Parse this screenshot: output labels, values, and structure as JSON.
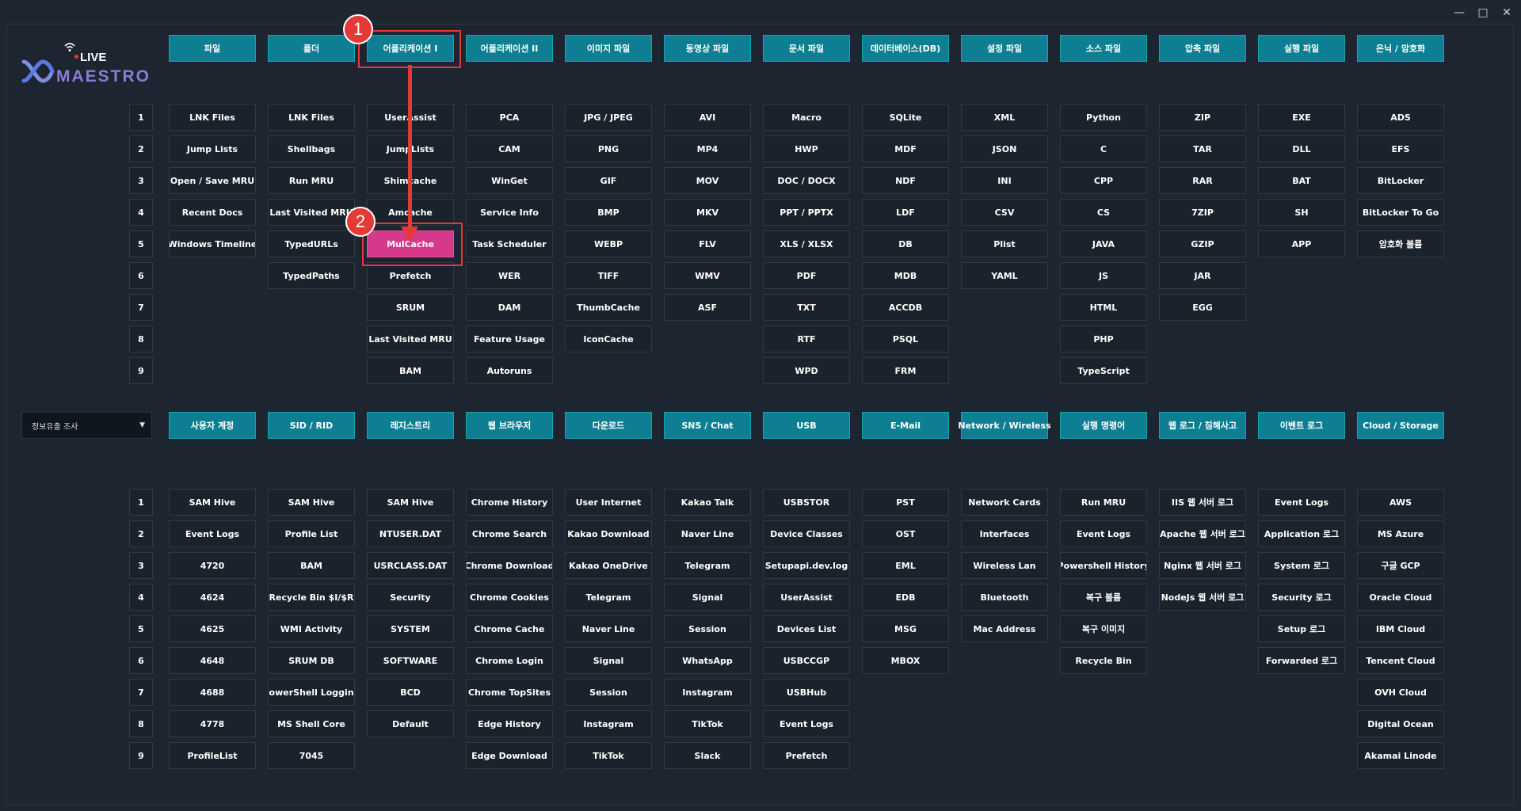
{
  "window_controls": {
    "minimize": "—",
    "maximize": "□",
    "close": "✕"
  },
  "logo": {
    "live": "LIVE",
    "main": "MAESTRO"
  },
  "top_categories": [
    "파일",
    "폴더",
    "어플리케이션 I",
    "어플리케이션 II",
    "이미지 파일",
    "동영상 파일",
    "문서 파일",
    "데이터베이스(DB)",
    "설정 파일",
    "소스 파일",
    "압축 파일",
    "실행 파일",
    "은닉 / 암호화"
  ],
  "top_rows": [
    [
      "LNK Files",
      "Jump Lists",
      "Open / Save MRU",
      "Recent Docs",
      "Windows Timeline",
      "",
      "",
      "",
      ""
    ],
    [
      "LNK Files",
      "Shellbags",
      "Run MRU",
      "Last Visited MRU",
      "TypedURLs",
      "TypedPaths",
      "",
      "",
      ""
    ],
    [
      "UserAssist",
      "JumpLists",
      "Shimcache",
      "Amcache",
      "MulCache",
      "Prefetch",
      "SRUM",
      "Last Visited MRU",
      "BAM"
    ],
    [
      "PCA",
      "CAM",
      "WinGet",
      "Service Info",
      "Task Scheduler",
      "WER",
      "DAM",
      "Feature Usage",
      "Autoruns"
    ],
    [
      "JPG / JPEG",
      "PNG",
      "GIF",
      "BMP",
      "WEBP",
      "TIFF",
      "ThumbCache",
      "IconCache",
      ""
    ],
    [
      "AVI",
      "MP4",
      "MOV",
      "MKV",
      "FLV",
      "WMV",
      "ASF",
      "",
      ""
    ],
    [
      "Macro",
      "HWP",
      "DOC / DOCX",
      "PPT / PPTX",
      "XLS / XLSX",
      "PDF",
      "TXT",
      "RTF",
      "WPD"
    ],
    [
      "SQLite",
      "MDF",
      "NDF",
      "LDF",
      "DB",
      "MDB",
      "ACCDB",
      "PSQL",
      "FRM"
    ],
    [
      "XML",
      "JSON",
      "INI",
      "CSV",
      "Plist",
      "YAML",
      "",
      "",
      ""
    ],
    [
      "Python",
      "C",
      "CPP",
      "CS",
      "JAVA",
      "JS",
      "HTML",
      "PHP",
      "TypeScript"
    ],
    [
      "ZIP",
      "TAR",
      "RAR",
      "7ZIP",
      "GZIP",
      "JAR",
      "EGG",
      "",
      ""
    ],
    [
      "EXE",
      "DLL",
      "BAT",
      "SH",
      "APP",
      "",
      "",
      "",
      ""
    ],
    [
      "ADS",
      "EFS",
      "BitLocker",
      "BitLocker To Go",
      "암호화 볼륨",
      "",
      "",
      "",
      ""
    ]
  ],
  "dropdown": {
    "value": "정보유출 조사",
    "caret": "▼"
  },
  "bottom_categories": [
    "사용자 계정",
    "SID / RID",
    "레지스트리",
    "웹 브라우저",
    "다운로드",
    "SNS / Chat",
    "USB",
    "E-Mail",
    "Network / Wireless",
    "실행 명령어",
    "웹 로그 / 침해사고",
    "이벤트 로그",
    "Cloud / Storage"
  ],
  "bottom_rows": [
    [
      "SAM Hive",
      "Event Logs",
      "4720",
      "4624",
      "4625",
      "4648",
      "4688",
      "4778",
      "ProfileList"
    ],
    [
      "SAM Hive",
      "Profile List",
      "BAM",
      "Recycle Bin $I/$R",
      "WMI Activity",
      "SRUM DB",
      "PowerShell Logging",
      "MS Shell Core",
      "7045"
    ],
    [
      "SAM Hive",
      "NTUSER.DAT",
      "USRCLASS.DAT",
      "Security",
      "SYSTEM",
      "SOFTWARE",
      "BCD",
      "Default",
      ""
    ],
    [
      "Chrome History",
      "Chrome Search",
      "Chrome Download",
      "Chrome Cookies",
      "Chrome Cache",
      "Chrome Login",
      "Chrome TopSites",
      "Edge History",
      "Edge Download"
    ],
    [
      "User Internet",
      "Kakao Download",
      "Kakao OneDrive",
      "Telegram",
      "Naver Line",
      "Signal",
      "Session",
      "Instagram",
      "TikTok"
    ],
    [
      "Kakao Talk",
      "Naver Line",
      "Telegram",
      "Signal",
      "Session",
      "WhatsApp",
      "Instagram",
      "TikTok",
      "Slack"
    ],
    [
      "USBSTOR",
      "Device Classes",
      "Setupapi.dev.log",
      "UserAssist",
      "Devices List",
      "USBCCGP",
      "USBHub",
      "Event Logs",
      "Prefetch"
    ],
    [
      "PST",
      "OST",
      "EML",
      "EDB",
      "MSG",
      "MBOX",
      "",
      "",
      ""
    ],
    [
      "Network Cards",
      "Interfaces",
      "Wireless Lan",
      "Bluetooth",
      "Mac Address",
      "",
      "",
      "",
      ""
    ],
    [
      "Run MRU",
      "Event Logs",
      "Powershell History",
      "복구 볼륨",
      "복구 이미지",
      "Recycle Bin",
      "",
      "",
      ""
    ],
    [
      "IIS 웹 서버 로그",
      "Apache 웹 서버 로그",
      "Nginx 웹 서버 로그",
      "NodeJs 웹 서버 로그",
      "",
      "",
      "",
      "",
      ""
    ],
    [
      "Event Logs",
      "Application 로그",
      "System 로그",
      "Security 로그",
      "Setup 로그",
      "Forwarded 로그",
      "",
      "",
      ""
    ],
    [
      "AWS",
      "MS Azure",
      "구글 GCP",
      "Oracle Cloud",
      "IBM Cloud",
      "Tencent Cloud",
      "OVH Cloud",
      "Digital Ocean",
      "Akamai Linode"
    ]
  ],
  "row_numbers": [
    "1",
    "2",
    "3",
    "4",
    "5",
    "6",
    "7",
    "8",
    "9"
  ],
  "annotations": {
    "step1": "1",
    "step2": "2"
  },
  "colors": {
    "accent": "#0e7f92",
    "highlight": "#d6398a",
    "annotation": "#e53935"
  }
}
